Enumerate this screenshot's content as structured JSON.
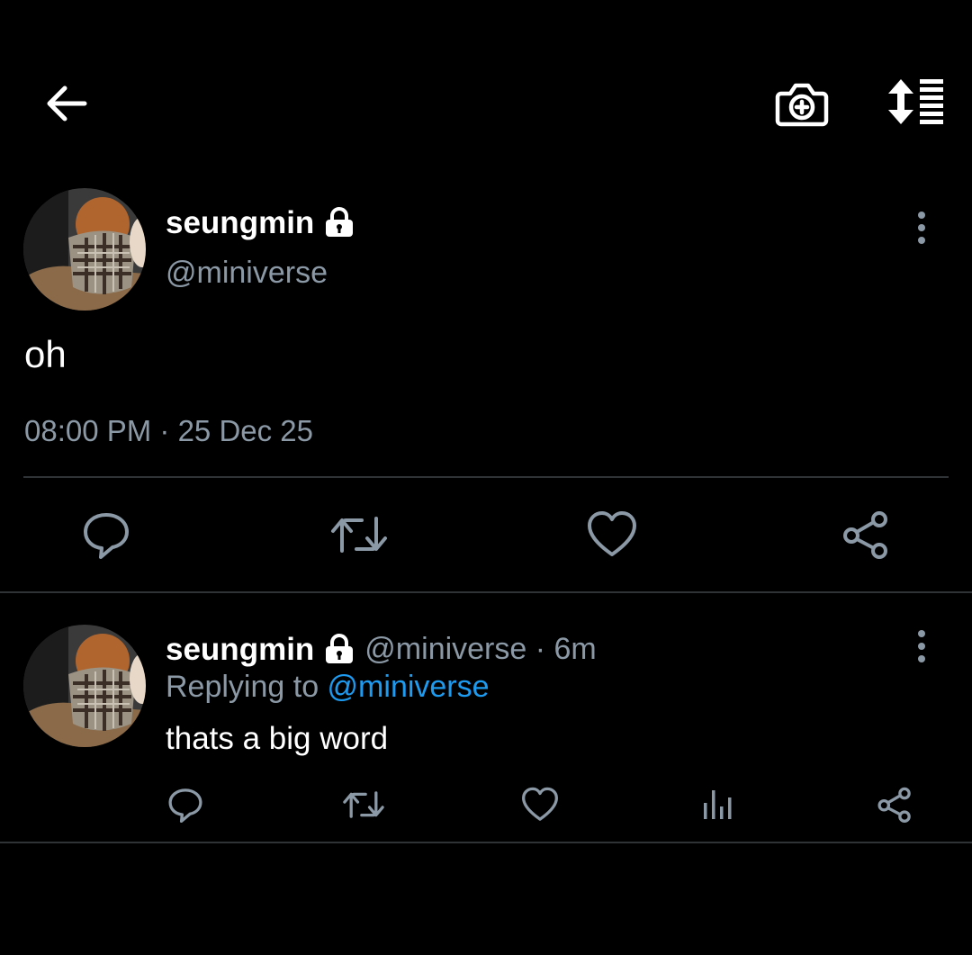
{
  "top_bar": {
    "back_icon": "arrow-left-icon",
    "camera_icon": "camera-plus-icon",
    "sort_icon": "sort-list-icon"
  },
  "main_tweet": {
    "display_name": "seungmin",
    "handle": "@miniverse",
    "text": "oh",
    "time": "08:00 PM",
    "separator": " · ",
    "date": "25 Dec 25",
    "protected_icon": "lock-icon",
    "actions": [
      "reply-icon",
      "retweet-icon",
      "like-icon",
      "share-icon"
    ]
  },
  "reply_tweet": {
    "display_name": "seungmin",
    "handle": "@miniverse",
    "separator": " · ",
    "age": "6m",
    "replying_prefix": "Replying to ",
    "replying_to": "@miniverse",
    "text": "thats a big word",
    "protected_icon": "lock-icon",
    "actions": [
      "reply-icon",
      "retweet-icon",
      "like-icon",
      "analytics-icon",
      "share-icon"
    ]
  },
  "colors": {
    "background": "#000000",
    "primary_text": "#ffffff",
    "secondary_text": "#8b98a5",
    "accent": "#1d9bf0",
    "divider": "#2f3336"
  }
}
